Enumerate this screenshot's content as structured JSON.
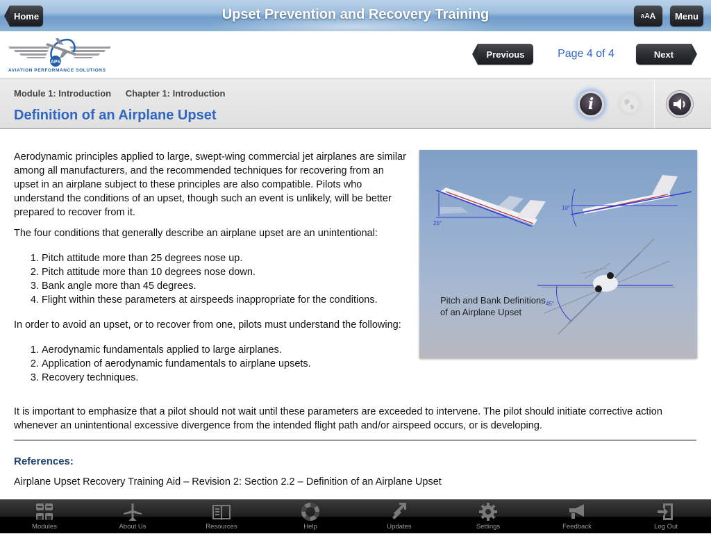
{
  "topbar": {
    "title": "Upset Prevention and Recovery Training",
    "home_label": "Home",
    "font_size_label": [
      "A",
      "A",
      "A"
    ],
    "menu_label": "Menu"
  },
  "logo": {
    "badge": "APS",
    "tagline": "AVIATION PERFORMANCE SOLUTIONS"
  },
  "pager": {
    "previous_label": "Previous",
    "page_indicator": "Page 4 of 4",
    "current_page": 4,
    "total_pages": 4,
    "next_label": "Next"
  },
  "header": {
    "module": "Module 1: Introduction",
    "chapter": "Chapter 1: Introduction",
    "title": "Definition of an Airplane Upset",
    "icons": [
      "info-icon",
      "globe-icon",
      "speaker-icon"
    ]
  },
  "content": {
    "intro": "Aerodynamic principles applied to large, swept-wing commercial jet airplanes are similar among all manufacturers, and the recommended techniques for recovering from an upset in an airplane subject to these principles are also compatible. Pilots who understand the conditions of an upset, though such an event is unlikely, will be better prepared to recover from it.",
    "conditions_lead": "The four conditions that generally describe an airplane upset are an unintentional:",
    "conditions": [
      "Pitch attitude more than 25 degrees nose up.",
      "Pitch attitude more than 10 degrees nose down.",
      "Bank angle more than 45 degrees.",
      "Flight within these parameters at airspeeds inappropriate for the conditions."
    ],
    "understand_lead": "In order to avoid an upset, or to recover from one, pilots must understand the following:",
    "understand": [
      "Aerodynamic fundamentals applied to large airplanes.",
      "Application of aerodynamic fundamentals to airplane upsets.",
      "Recovery techniques."
    ],
    "emphasis": "It is important to emphasize that a pilot should not wait until these parameters are exceeded to intervene. The pilot should initiate corrective action whenever an unintentional excessive divergence from the intended flight path and/or airspeed occurs, or is developing.",
    "references_title": "References:",
    "references": [
      "Airplane Upset Recovery Training Aid – Revision 2: Section 2.2 – Definition of an Airplane Upset"
    ]
  },
  "figure": {
    "caption": "Pitch and Bank Definitions of an Airplane Upset",
    "angle_labels": [
      "25°",
      "10°",
      "45°"
    ],
    "accent_color": "#3a3fd6"
  },
  "tabbar": {
    "items": [
      {
        "label": "Modules",
        "icon": "modules-icon"
      },
      {
        "label": "About Us",
        "icon": "airplane-icon"
      },
      {
        "label": "Resources",
        "icon": "book-icon"
      },
      {
        "label": "Help",
        "icon": "lifebuoy-icon"
      },
      {
        "label": "Updates",
        "icon": "updates-icon"
      },
      {
        "label": "Settings",
        "icon": "gear-icon"
      },
      {
        "label": "Feedback",
        "icon": "megaphone-icon"
      },
      {
        "label": "Log Out",
        "icon": "logout-icon"
      }
    ]
  }
}
